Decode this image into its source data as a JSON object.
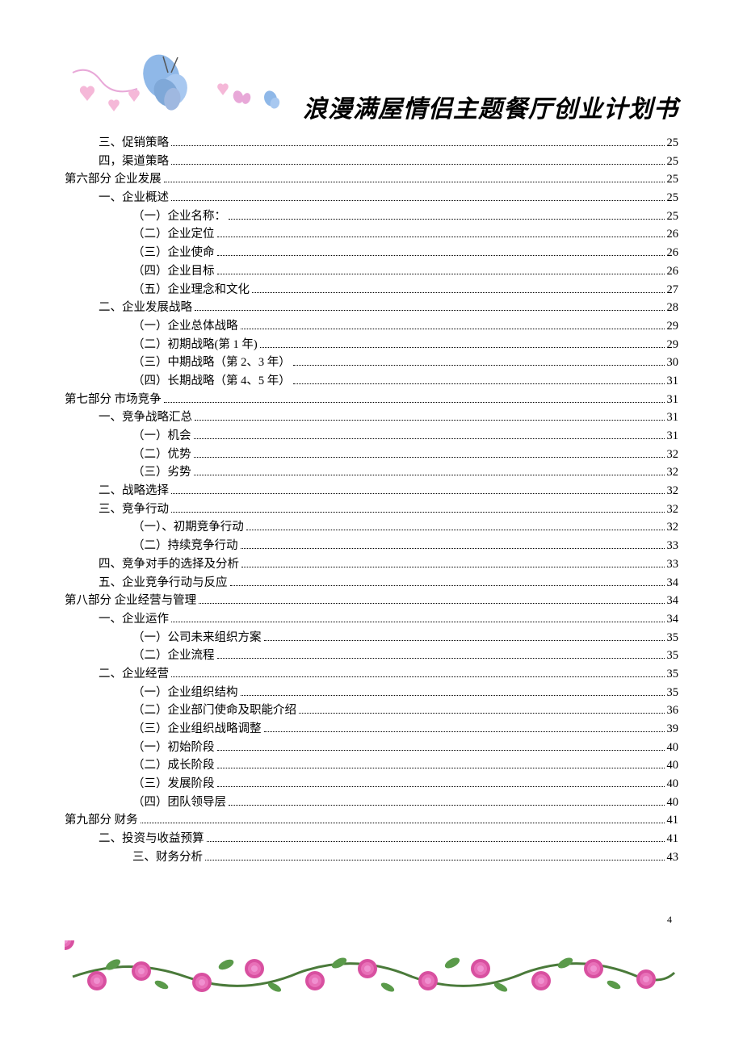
{
  "title": "浪漫满屋情侣主题餐厅创业计划书",
  "page_number": "4",
  "toc": [
    {
      "indent": 1,
      "label": "三、促销策略",
      "page": "25"
    },
    {
      "indent": 1,
      "label": "四，渠道策略",
      "page": "25"
    },
    {
      "indent": 0,
      "label": "第六部分 企业发展",
      "page": "25"
    },
    {
      "indent": 1,
      "label": "一、企业概述",
      "page": "25"
    },
    {
      "indent": 2,
      "label": "（一）企业名称：",
      "page": "25"
    },
    {
      "indent": 2,
      "label": "（二）企业定位",
      "page": "26"
    },
    {
      "indent": 2,
      "label": "（三）企业使命",
      "page": "26"
    },
    {
      "indent": 2,
      "label": "（四）企业目标",
      "page": "26"
    },
    {
      "indent": 2,
      "label": "（五）企业理念和文化",
      "page": "27"
    },
    {
      "indent": 1,
      "label": "二、企业发展战略",
      "page": "28"
    },
    {
      "indent": 2,
      "label": "（一）企业总体战略",
      "page": "29"
    },
    {
      "indent": 2,
      "label": "（二）初期战略(第 1 年)",
      "page": "29"
    },
    {
      "indent": 2,
      "label": "（三）中期战略（第 2、3 年）",
      "page": "30"
    },
    {
      "indent": 2,
      "label": "（四）长期战略（第 4、5 年）",
      "page": "31"
    },
    {
      "indent": 0,
      "label": "第七部分 市场竞争",
      "page": "31"
    },
    {
      "indent": 1,
      "label": "一、竞争战略汇总",
      "page": "31"
    },
    {
      "indent": 2,
      "label": "（一）机会",
      "page": "31"
    },
    {
      "indent": 2,
      "label": "（二）优势",
      "page": "32"
    },
    {
      "indent": 2,
      "label": "（三）劣势",
      "page": "32"
    },
    {
      "indent": 1,
      "label": "二、战略选择",
      "page": "32"
    },
    {
      "indent": 1,
      "label": "三、竞争行动",
      "page": "32"
    },
    {
      "indent": 2,
      "label": "（一）、初期竞争行动",
      "page": "32"
    },
    {
      "indent": 2,
      "label": "（二）持续竞争行动",
      "page": "33"
    },
    {
      "indent": 1,
      "label": "四、竞争对手的选择及分析",
      "page": "33"
    },
    {
      "indent": 1,
      "label": "五、企业竞争行动与反应",
      "page": "34"
    },
    {
      "indent": 0,
      "label": "第八部分 企业经营与管理",
      "page": "34"
    },
    {
      "indent": 1,
      "label": "一、企业运作",
      "page": "34"
    },
    {
      "indent": 2,
      "label": "（一）公司未来组织方案",
      "page": "35"
    },
    {
      "indent": 2,
      "label": "（二）企业流程",
      "page": "35"
    },
    {
      "indent": 1,
      "label": "二、企业经营",
      "page": "35"
    },
    {
      "indent": 2,
      "label": "（一）企业组织结构",
      "page": "35"
    },
    {
      "indent": 2,
      "label": "（二）企业部门使命及职能介绍",
      "page": "36"
    },
    {
      "indent": 2,
      "label": "（三）企业组织战略调整",
      "page": "39"
    },
    {
      "indent": 2,
      "label": "（一）初始阶段",
      "page": "40"
    },
    {
      "indent": 2,
      "label": "（二）成长阶段",
      "page": "40"
    },
    {
      "indent": 2,
      "label": "（三）发展阶段",
      "page": "40"
    },
    {
      "indent": 2,
      "label": "（四）团队领导层",
      "page": "40"
    },
    {
      "indent": 0,
      "label": "第九部分   财务",
      "page": "41"
    },
    {
      "indent": 1,
      "label": "二、投资与收益预算",
      "page": "41"
    },
    {
      "indent": 2,
      "label": "三、财务分析",
      "page": "43"
    }
  ]
}
